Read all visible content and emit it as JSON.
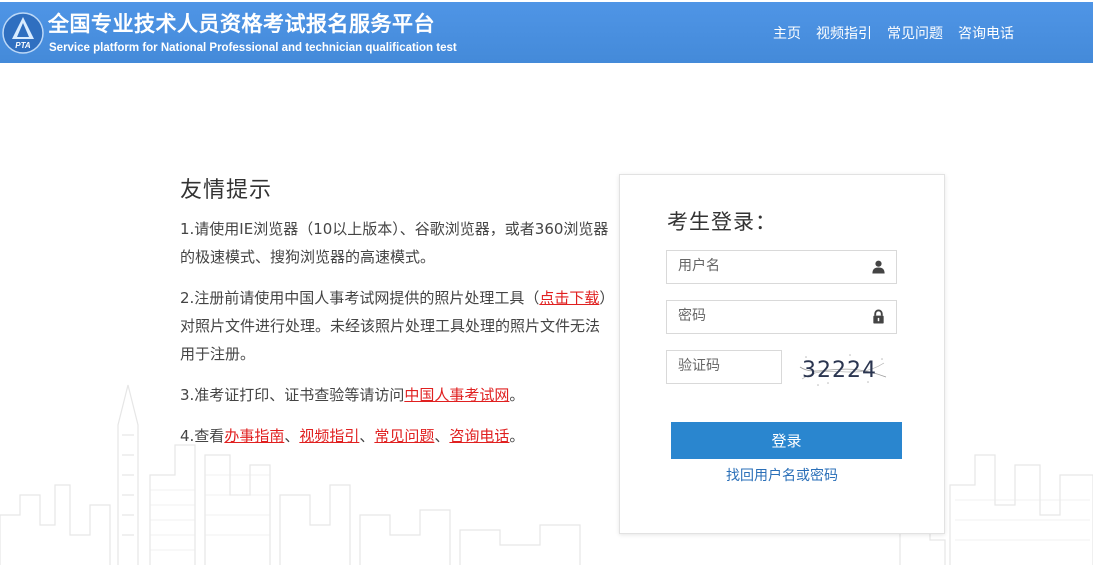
{
  "header": {
    "title_cn": "全国专业技术人员资格考试报名服务平台",
    "title_en": "Service platform for National Professional and technician qualification test",
    "logo_text": "PTA",
    "nav": [
      "主页",
      "视频指引",
      "常见问题",
      "咨询电话"
    ]
  },
  "tips": {
    "heading": "友情提示",
    "item1": "1.请使用IE浏览器（10以上版本）、谷歌浏览器，或者360浏览器的极速模式、搜狗浏览器的高速模式。",
    "item2_prefix": "2.注册前请使用中国人事考试网提供的照片处理工具（",
    "item2_link": "点击下载",
    "item2_suffix": "）对照片文件进行处理。未经该照片处理工具处理的照片文件无法用于注册。",
    "item3_prefix": "3.准考证打印、证书查验等请访问",
    "item3_link": "中国人事考试网",
    "item3_suffix": "。",
    "item4_prefix": "4.查看",
    "item4_links": [
      "办事指南",
      "视频指引",
      "常见问题",
      "咨询电话"
    ],
    "item4_sep": "、",
    "item4_suffix": "。"
  },
  "login": {
    "title": "考生登录：",
    "username_placeholder": "用户名",
    "password_placeholder": "密码",
    "captcha_placeholder": "验证码",
    "captcha_text": "32224",
    "submit_label": "登录",
    "recover_label": "找回用户名或密码"
  },
  "colors": {
    "header_bg": "#4a90e2",
    "button_bg": "#2a86cf",
    "link_red": "#e02020",
    "link_blue": "#2a6fb8"
  },
  "icons": [
    "pta-logo-icon",
    "user-icon",
    "lock-icon"
  ]
}
